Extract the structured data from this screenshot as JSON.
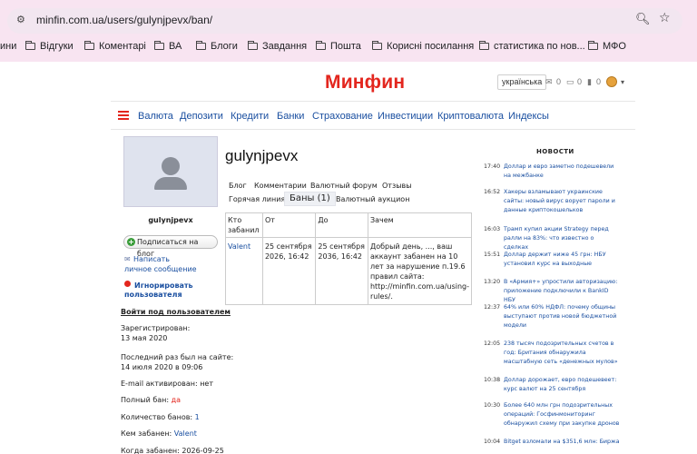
{
  "browser": {
    "url": "minfin.com.ua/users/gulynjpevx/ban/",
    "bookmarks": [
      "ини",
      "Відгуки",
      "Коментарі",
      "ВА",
      "Блоги",
      "Завдання",
      "Пошта",
      "Корисні посилання",
      "статистика по нов...",
      "МФО"
    ]
  },
  "header": {
    "logo": "Минфин",
    "language": "українська",
    "counter1": "0",
    "counter2": "0",
    "counter3": "0"
  },
  "nav": [
    "Валюта",
    "Депозити",
    "Кредити",
    "Банки",
    "Страхование",
    "Инвестиции",
    "Криптовалюта",
    "Индексы"
  ],
  "sidebar": {
    "username": "gulynjpevx",
    "subscribe_label": "Подписаться на блог",
    "message_link_line1": "Написать",
    "message_link_line2": "личное сообщение",
    "ignore_line1": "Игнорировать",
    "ignore_line2": "пользователя",
    "login_as": "Войти под пользователем",
    "registered_label": "Зарегистрирован:",
    "registered_value": "13 мая 2020",
    "last_seen_label": "Последний раз был на сайте:",
    "last_seen_value": "14 июля 2020 в 09:06",
    "email_label": "E-mail активирован: нет",
    "full_ban_label": "Полный бан:",
    "full_ban_value": "да",
    "bans_count_label": "Количество банов:",
    "bans_count_value": "1",
    "banned_by_label": "Кем забанен:",
    "banned_by_value": "Valent",
    "ban_date_label": "Когда забанен: 2026-09-25"
  },
  "main": {
    "title": "gulynjpevx",
    "tabs": [
      "Блог",
      "Комментарии",
      "Валютный форум",
      "Отзывы",
      "Горячая линия",
      "Баны (1)",
      "Валютный аукцион"
    ],
    "table": {
      "headers": [
        "Кто забанил",
        "От",
        "До",
        "Зачем"
      ],
      "row": {
        "who": "Valent",
        "from": "25 сентября 2026, 16:42",
        "to": "25 сентября 2036, 16:42",
        "reason": "Добрый день, ..., ваш аккаунт забанен на 10 лет за нарушение п.19.6 правил сайта: http://minfin.com.ua/using-rules/."
      }
    }
  },
  "news": {
    "title": "НОВОСТИ",
    "items": [
      {
        "time": "17:40",
        "text": "Доллар и евро заметно подешевели на межбанке"
      },
      {
        "time": "16:52",
        "text": "Хакеры взламывают украинские сайты: новый вирус ворует пароли и данные криптокошельков"
      },
      {
        "time": "16:03",
        "text": "Трамп купил акции Strategy перед ралли на 83%: что известно о сделках"
      },
      {
        "time": "15:51",
        "text": "Доллар держит ниже 45 грн: НБУ установил курс на выходные"
      },
      {
        "time": "13:20",
        "text": "В «Армия+» упростили авторизацию: приложение подключили к BankID НБУ"
      },
      {
        "time": "12:37",
        "text": "64% или 60% НДФЛ: почему общины выступают против новой бюджетной модели"
      },
      {
        "time": "12:05",
        "text": "238 тысяч подозрительных счетов в год: Британия обнаружила масштабную сеть «денежных мулов»"
      },
      {
        "time": "10:38",
        "text": "Доллар дорожает, евро подешевеет: курс валют на 25 сентября"
      },
      {
        "time": "10:30",
        "text": "Более 640 млн грн подозрительных операций: Госфинмониторинг обнаружил схему при закупке дронов"
      },
      {
        "time": "10:04",
        "text": "Bitget взломали на $351,6 млн: Биржа"
      }
    ]
  }
}
